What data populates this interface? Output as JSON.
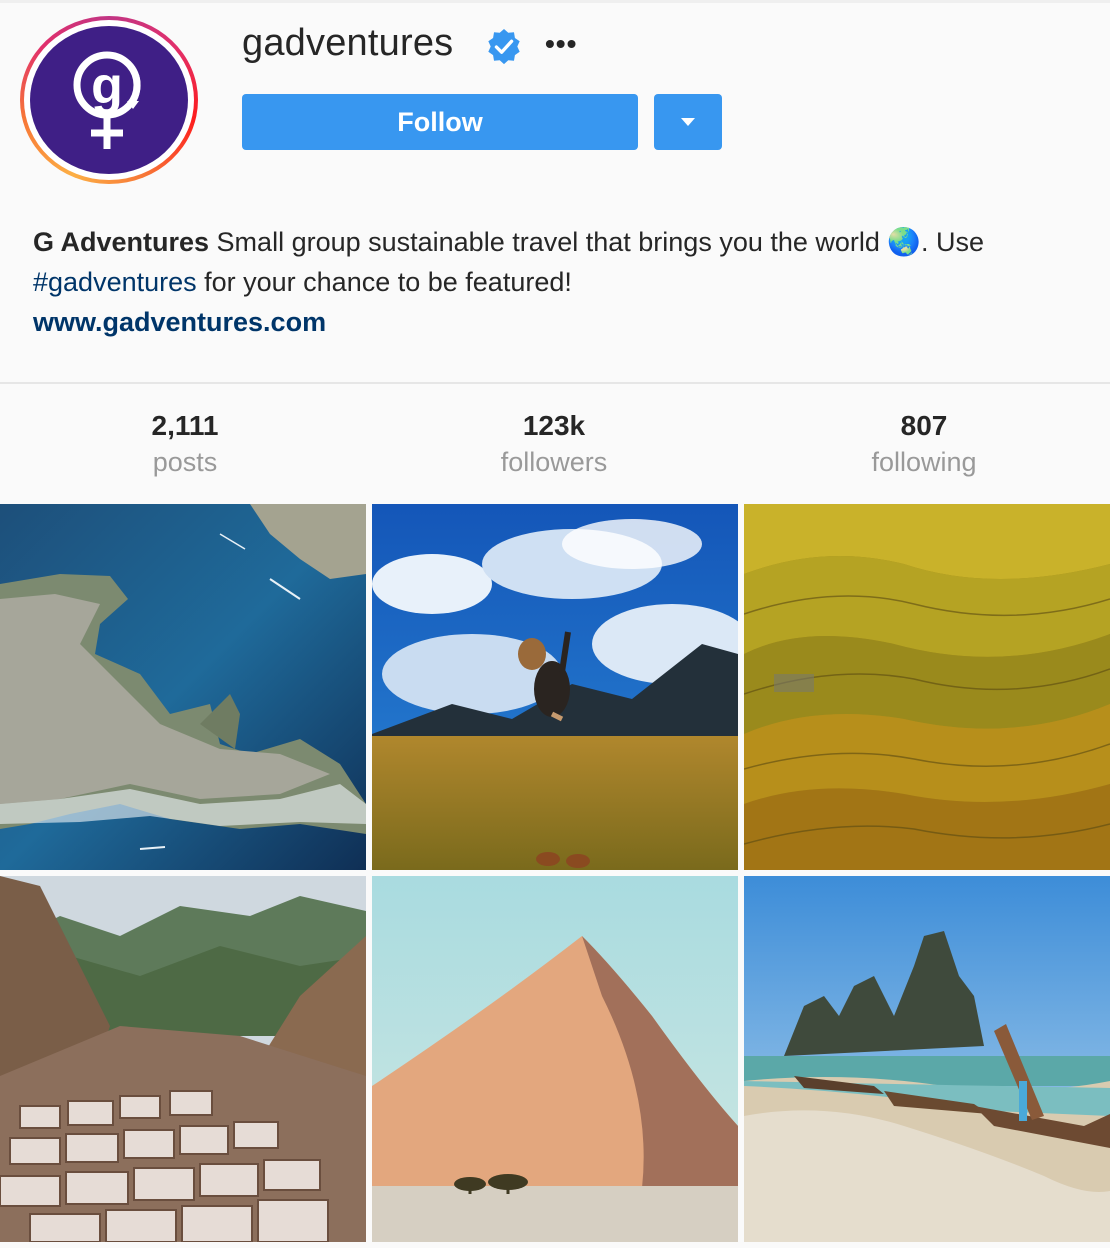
{
  "profile": {
    "username": "gadventures",
    "verified": true,
    "avatar_icon": "g-adventures-logo-icon",
    "follow_label": "Follow",
    "more_label": "•••"
  },
  "bio": {
    "name": "G Adventures",
    "text_1": " Small group sustainable travel that brings you the world ",
    "emoji": "🌏",
    "text_2": ". Use ",
    "hashtag": "#gadventures",
    "text_3": " for your chance to be featured!",
    "website": "www.gadventures.com"
  },
  "stats": [
    {
      "value": "2,111",
      "label": "posts"
    },
    {
      "value": "123k",
      "label": "followers"
    },
    {
      "value": "807",
      "label": "following"
    }
  ],
  "posts": [
    {
      "subject": "aerial-coastline-town"
    },
    {
      "subject": "jumping-person-over-field"
    },
    {
      "subject": "rice-terraces"
    },
    {
      "subject": "salt-mines-valley"
    },
    {
      "subject": "sand-dune-desert"
    },
    {
      "subject": "longtail-boats-beach"
    }
  ],
  "colors": {
    "accent": "#3897f0",
    "link": "#003569",
    "avatar_bg": "#3f1f86",
    "verified": "#3897f0",
    "muted": "#999999"
  }
}
